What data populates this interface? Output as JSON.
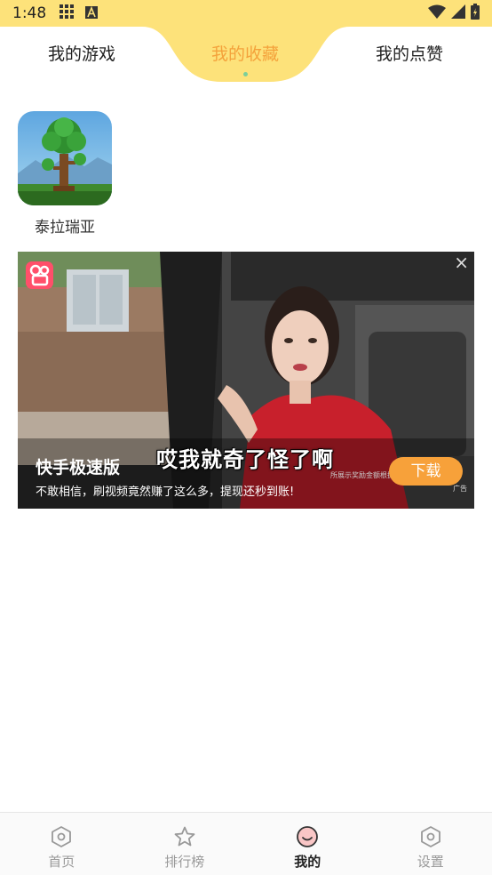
{
  "status_bar": {
    "time": "1:48",
    "icons": [
      "grid-icon",
      "a-icon",
      "wifi-icon",
      "signal-icon",
      "battery-icon"
    ]
  },
  "tabs": [
    {
      "label": "我的游戏",
      "active": false
    },
    {
      "label": "我的收藏",
      "active": true
    },
    {
      "label": "我的点赞",
      "active": false
    }
  ],
  "favorites": [
    {
      "name": "泰拉瑞亚",
      "icon": "terraria-tree-icon"
    }
  ],
  "ad": {
    "title": "快手极速版",
    "description": "不敢相信，刷视频竟然赚了这么多，提现还秒到账!",
    "button_label": "下载",
    "video_caption": "哎我就奇了怪了啊",
    "small_text": "所展示奖励金额根据任务完成情况而定",
    "ad_tag": "广告",
    "close_label": "×"
  },
  "bottom_nav": [
    {
      "label": "首页",
      "icon": "home-icon",
      "active": false
    },
    {
      "label": "排行榜",
      "icon": "star-icon",
      "active": false
    },
    {
      "label": "我的",
      "icon": "smile-icon",
      "active": true
    },
    {
      "label": "设置",
      "icon": "settings-icon",
      "active": false
    }
  ],
  "colors": {
    "accent": "#f4a23b",
    "status_bar": "#fde27a",
    "download_button": "#f7a13a",
    "tab_dot": "#7ccf9a"
  }
}
